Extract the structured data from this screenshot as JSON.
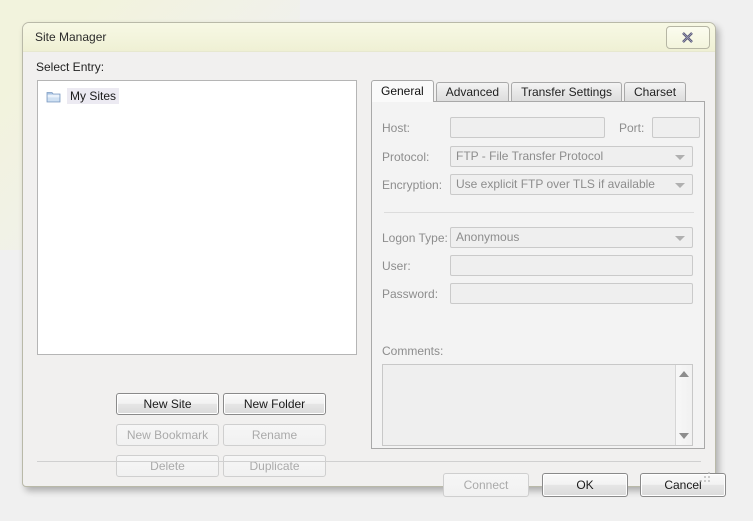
{
  "window": {
    "title": "Site Manager",
    "close_icon": "close-x-icon"
  },
  "left_pane": {
    "select_label": "Select Entry:",
    "tree": {
      "items": [
        {
          "label": "My Sites",
          "icon": "folder-icon",
          "selected": true
        }
      ]
    },
    "buttons": [
      {
        "label": "New Site",
        "enabled": true
      },
      {
        "label": "New Folder",
        "enabled": true
      },
      {
        "label": "New Bookmark",
        "enabled": false
      },
      {
        "label": "Rename",
        "enabled": false
      },
      {
        "label": "Delete",
        "enabled": false
      },
      {
        "label": "Duplicate",
        "enabled": false
      }
    ]
  },
  "right_pane": {
    "tabs": [
      {
        "label": "General",
        "selected": true
      },
      {
        "label": "Advanced",
        "selected": false
      },
      {
        "label": "Transfer Settings",
        "selected": false
      },
      {
        "label": "Charset",
        "selected": false
      }
    ],
    "general": {
      "host_label": "Host:",
      "host_value": "",
      "port_label": "Port:",
      "port_value": "",
      "protocol_label": "Protocol:",
      "protocol_value": "FTP - File Transfer Protocol",
      "encryption_label": "Encryption:",
      "encryption_value": "Use explicit FTP over TLS if available",
      "logon_type_label": "Logon Type:",
      "logon_type_value": "Anonymous",
      "user_label": "User:",
      "user_value": "",
      "password_label": "Password:",
      "password_value": "",
      "comments_label": "Comments:",
      "comments_value": ""
    }
  },
  "footer": {
    "buttons": [
      {
        "label": "Connect",
        "enabled": false
      },
      {
        "label": "OK",
        "enabled": true
      },
      {
        "label": "Cancel",
        "enabled": true
      }
    ]
  },
  "colors": {
    "titlebar": "#f3f4dc",
    "dialog_bg": "#f1f0ef",
    "tree_bg": "#ffffff",
    "disabled_text": "#8d8d8d"
  }
}
